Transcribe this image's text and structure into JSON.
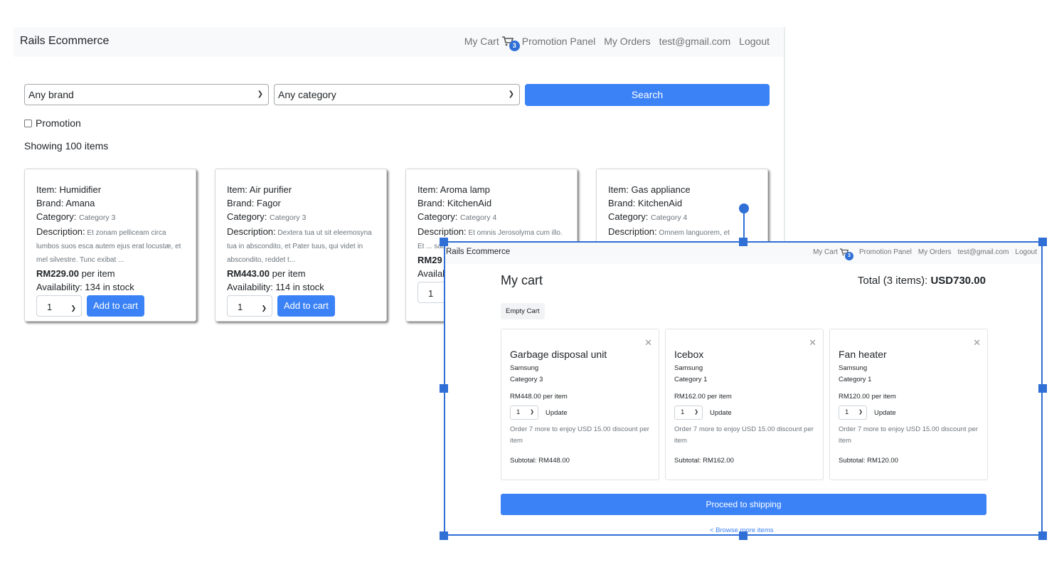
{
  "back": {
    "nav": {
      "brand": "Rails Ecommerce",
      "my_cart": "My Cart",
      "cart_count": "3",
      "promotion_panel": "Promotion Panel",
      "my_orders": "My Orders",
      "email": "test@gmail.com",
      "logout": "Logout"
    },
    "filters": {
      "brand_selected": "Any brand",
      "category_selected": "Any category",
      "search_label": "Search",
      "promotion_label": "Promotion"
    },
    "showing": "Showing 100 items",
    "products": [
      {
        "item": "Item: Humidifier",
        "brand": "Brand: Amana",
        "category_label": "Category:",
        "category": "Category 3",
        "desc_label": "Description:",
        "desc": "Et zonam pelliceam circa lumbos suos esca autem ejus erat locustæ, et mel silvestre. Tunc exibat ...",
        "price": "RM229.00",
        "per_item": " per item",
        "availability": "Availability: 134 in stock",
        "qty": "1",
        "add": "Add to cart"
      },
      {
        "item": "Item: Air purifier",
        "brand": "Brand: Fagor",
        "category_label": "Category:",
        "category": "Category 3",
        "desc_label": "Description:",
        "desc": "Dextera tua ut sit eleemosyna tua in abscondito, et Pater tuus, qui videt in abscondito, reddet t...",
        "price": "RM443.00",
        "per_item": " per item",
        "availability": "Availability: 114 in stock",
        "qty": "1",
        "add": "Add to cart"
      },
      {
        "item": "Item: Aroma lamp",
        "brand": "Brand: KitchenAid",
        "category_label": "Category:",
        "category": "Category 4",
        "desc_label": "Description:",
        "desc": "Et omnis Jerosolyma cum illo. Et ... sacerdo",
        "price": "RM29",
        "per_item": "",
        "availability": "Availab",
        "qty": "1",
        "add": ""
      },
      {
        "item": "Item: Gas appliance",
        "brand": "Brand: KitchenAid",
        "category_label": "Category:",
        "category": "Category 4",
        "desc_label": "Description:",
        "desc": "Omnem languorem, et",
        "price": "",
        "per_item": "",
        "availability": "",
        "qty": "",
        "add": ""
      }
    ]
  },
  "front": {
    "nav": {
      "brand": "Rails Ecommerce",
      "my_cart": "My Cart",
      "cart_count": "3",
      "promotion_panel": "Promotion Panel",
      "my_orders": "My Orders",
      "email": "test@gmail.com",
      "logout": "Logout"
    },
    "title": "My cart",
    "total_label": "Total (3 items): ",
    "total_value": "USD730.00",
    "empty_cart": "Empty Cart",
    "items": [
      {
        "name": "Garbage disposal unit",
        "brand": "Samsung",
        "category": "Category 3",
        "price": "RM448.00 per item",
        "qty": "1",
        "update": "Update",
        "promo": "Order 7 more to enjoy USD 15.00 discount per item",
        "subtotal": "Subtotal: RM448.00"
      },
      {
        "name": "Icebox",
        "brand": "Samsung",
        "category": "Category 1",
        "price": "RM162.00 per item",
        "qty": "1",
        "update": "Update",
        "promo": "Order 7 more to enjoy USD 15.00 discount per item",
        "subtotal": "Subtotal: RM162.00"
      },
      {
        "name": "Fan heater",
        "brand": "Samsung",
        "category": "Category 1",
        "price": "RM120.00 per item",
        "qty": "1",
        "update": "Update",
        "promo": "Order 7 more to enjoy USD 15.00 discount per item",
        "subtotal": "Subtotal: RM120.00"
      }
    ],
    "proceed": "Proceed to shipping",
    "browse": "< Browse more items"
  },
  "colors": {
    "primary": "#3b82f6",
    "selection": "#2f6fd6",
    "navbar": "#f8f9fa"
  },
  "icons": {
    "cart": "cart-icon",
    "close": "close-icon",
    "chevron": "chevron-down-icon"
  }
}
